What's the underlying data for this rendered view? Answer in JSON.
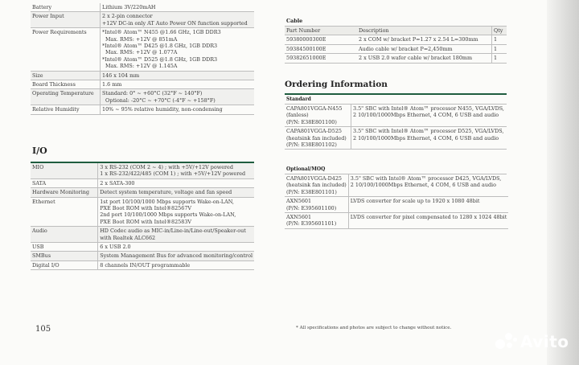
{
  "specs": [
    {
      "k": "Battery",
      "v": [
        "Lithium 3V/220mAH"
      ]
    },
    {
      "k": "Power Input",
      "v": [
        "2 x 2-pin connector",
        "+12V DC-in only AT Auto Power ON function supported"
      ]
    },
    {
      "k": "Power Requirements",
      "v": [
        "*Intel® Atom™ N455 @1.66 GHz, 1GB DDR3",
        "Max. RMS: +12V @ 851mA",
        "*Intel® Atom™ D425 @1.8 GHz, 1GB DDR3",
        "Max. RMS: +12V @ 1.077A",
        "*Intel® Atom™ D525 @1.8 GHz, 1GB DDR3",
        "Max. RMS: +12V @ 1.145A"
      ]
    },
    {
      "k": "Size",
      "v": [
        "146 x 104 mm"
      ]
    },
    {
      "k": "Board Thickness",
      "v": [
        "1.6 mm"
      ]
    },
    {
      "k": "Operating Temperature",
      "v": [
        "Standard: 0° ~ +60°C (32°F ~ 140°F)",
        "Optional: -20°C ~ +70°C (-4°F ~ +158°F)"
      ]
    },
    {
      "k": "Relative Humidity",
      "v": [
        "10% ~ 95% relative humidity, non-condensing"
      ]
    }
  ],
  "io_title": "I/O",
  "io": [
    {
      "k": "MIO",
      "v": [
        "3 x RS-232 (COM 2 ~ 4) ; with +5V/+12V powered",
        "1 x RS-232/422/485 (COM 1) ; with +5V/+12V powered"
      ]
    },
    {
      "k": "SATA",
      "v": [
        "2 x SATA-300"
      ]
    },
    {
      "k": "Hardware Monitoring",
      "v": [
        "Detect system temperature, voltage and fan speed"
      ]
    },
    {
      "k": "Ethernet",
      "v": [
        "1st port 10/100/1000 Mbps supports Wake-on-LAN,",
        "PXE Boot ROM with Intel®82567V",
        "2nd port 10/100/1000 Mbps supports Wake-on-LAN,",
        "PXE Boot ROM with Intel®82583V"
      ]
    },
    {
      "k": "Audio",
      "v": [
        "HD Codec audio as MIC-in/Line-in/Line-out/Speaker-out",
        "with Realtek ALC662"
      ]
    },
    {
      "k": "USB",
      "v": [
        "6 x USB 2.0"
      ]
    },
    {
      "k": "SMBus",
      "v": [
        "System Management Bus for advanced monitoring/control"
      ]
    },
    {
      "k": "Digital I/O",
      "v": [
        "8 channels IN/OUT programmable"
      ]
    }
  ],
  "cable": {
    "title": "Cable",
    "headers": [
      "Part Number",
      "Description",
      "Qty"
    ],
    "rows": [
      {
        "pn": "59380000300E",
        "desc": "2 x COM w/ bracket P=1.27 x 2.54 L=300mm",
        "qty": "1"
      },
      {
        "pn": "59384500100E",
        "desc": "Audio cable w/ bracket P=2,450mm",
        "qty": "1"
      },
      {
        "pn": "59382651000E",
        "desc": "2 x USB 2.0 wafer cable w/ bracket 180mm",
        "qty": "1"
      }
    ]
  },
  "ordering": {
    "title": "Ordering Information",
    "standard_label": "Standard",
    "standard": [
      {
        "m": [
          "CAPA801VGGA-N455",
          "(fanless)",
          "(P/N: E38E801100)"
        ],
        "d": [
          "3.5\" SBC with Intel® Atom™ processor N455, VGA/LVDS,",
          "2 10/100/1000Mbps Ethernet, 4 COM, 6 USB and audio"
        ]
      },
      {
        "m": [
          "CAPA801VGGA-D525",
          "(heatsink fan included)",
          "(P/N: E38E801102)"
        ],
        "d": [
          "3.5\" SBC with Intel® Atom™ processor D525, VGA/LVDS,",
          "2 10/100/1000Mbps Ethernet, 4 COM, 6 USB and audio"
        ]
      }
    ],
    "optional_label": "Optional/MOQ",
    "optional": [
      {
        "m": [
          "CAPA801VGGA-D425",
          "(heatsink fan included)",
          "(P/N: E38E801101)"
        ],
        "d": [
          "3.5\" SBC with Intel® Atom™ processor D425, VGA/LVDS,",
          "2 10/100/1000Mbps Ethernet, 4 COM, 6 USB and audio"
        ]
      },
      {
        "m": [
          "AXN5601",
          "(P/N: E395601100)"
        ],
        "d": [
          "LVDS converter for scale up to 1920 x 1080 48bit"
        ]
      },
      {
        "m": [
          "AXN5601",
          "(P/N: E395601101)"
        ],
        "d": [
          "LVDS converter for pixel compensated to 1280 x 1024 48bit"
        ]
      }
    ]
  },
  "page_number": "105",
  "footnote": "* All specifications and photos are subject to change without notice.",
  "watermark": "Avito"
}
